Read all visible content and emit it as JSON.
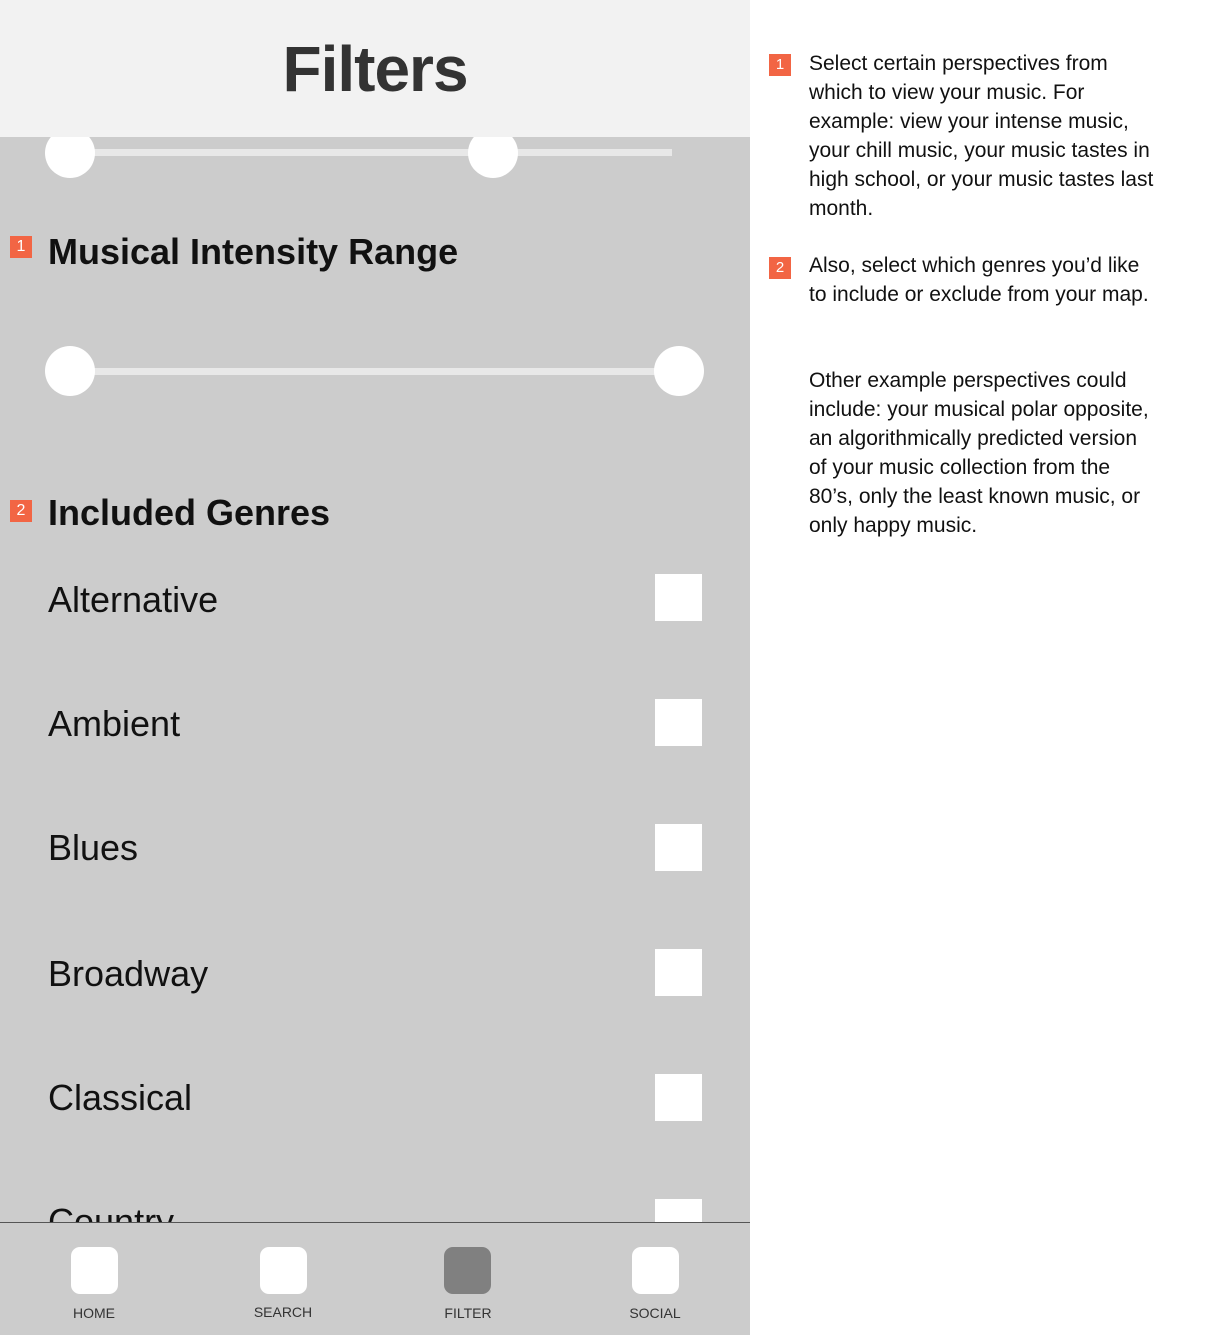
{
  "header": {
    "title": "Filters"
  },
  "sections": {
    "intensity": {
      "badge": "1",
      "title": "Musical Intensity Range"
    },
    "genres": {
      "badge": "2",
      "title": "Included Genres"
    }
  },
  "genres": [
    {
      "label": "Alternative",
      "checked": false
    },
    {
      "label": "Ambient",
      "checked": false
    },
    {
      "label": "Blues",
      "checked": false
    },
    {
      "label": "Broadway",
      "checked": false
    },
    {
      "label": "Classical",
      "checked": false
    },
    {
      "label": "Country",
      "checked": false
    }
  ],
  "nav": {
    "items": [
      {
        "label": "HOME",
        "icon": "home-icon",
        "active": false
      },
      {
        "label": "SEARCH",
        "icon": "search-icon",
        "active": false
      },
      {
        "label": "FILTER",
        "icon": "filter-icon",
        "active": true
      },
      {
        "label": "SOCIAL",
        "icon": "social-icon",
        "active": false
      }
    ]
  },
  "notes": [
    {
      "badge": "1",
      "text": "Select certain perspectives from which to view your music. For example: view your intense music, your chill music, your music tastes in high school, or your music tastes last month."
    },
    {
      "badge": "2",
      "text": "Also, select which genres you’d like to include or exclude from your map."
    },
    {
      "text": "Other example perspectives could include: your musical polar opposite, an algorithmically predicted version of your music collection from the 80’s, only the least known music, or only happy music."
    }
  ],
  "colors": {
    "badge": "#f26544",
    "panel": "#cccccc",
    "header": "#f2f2f2",
    "active_nav": "#808080"
  }
}
